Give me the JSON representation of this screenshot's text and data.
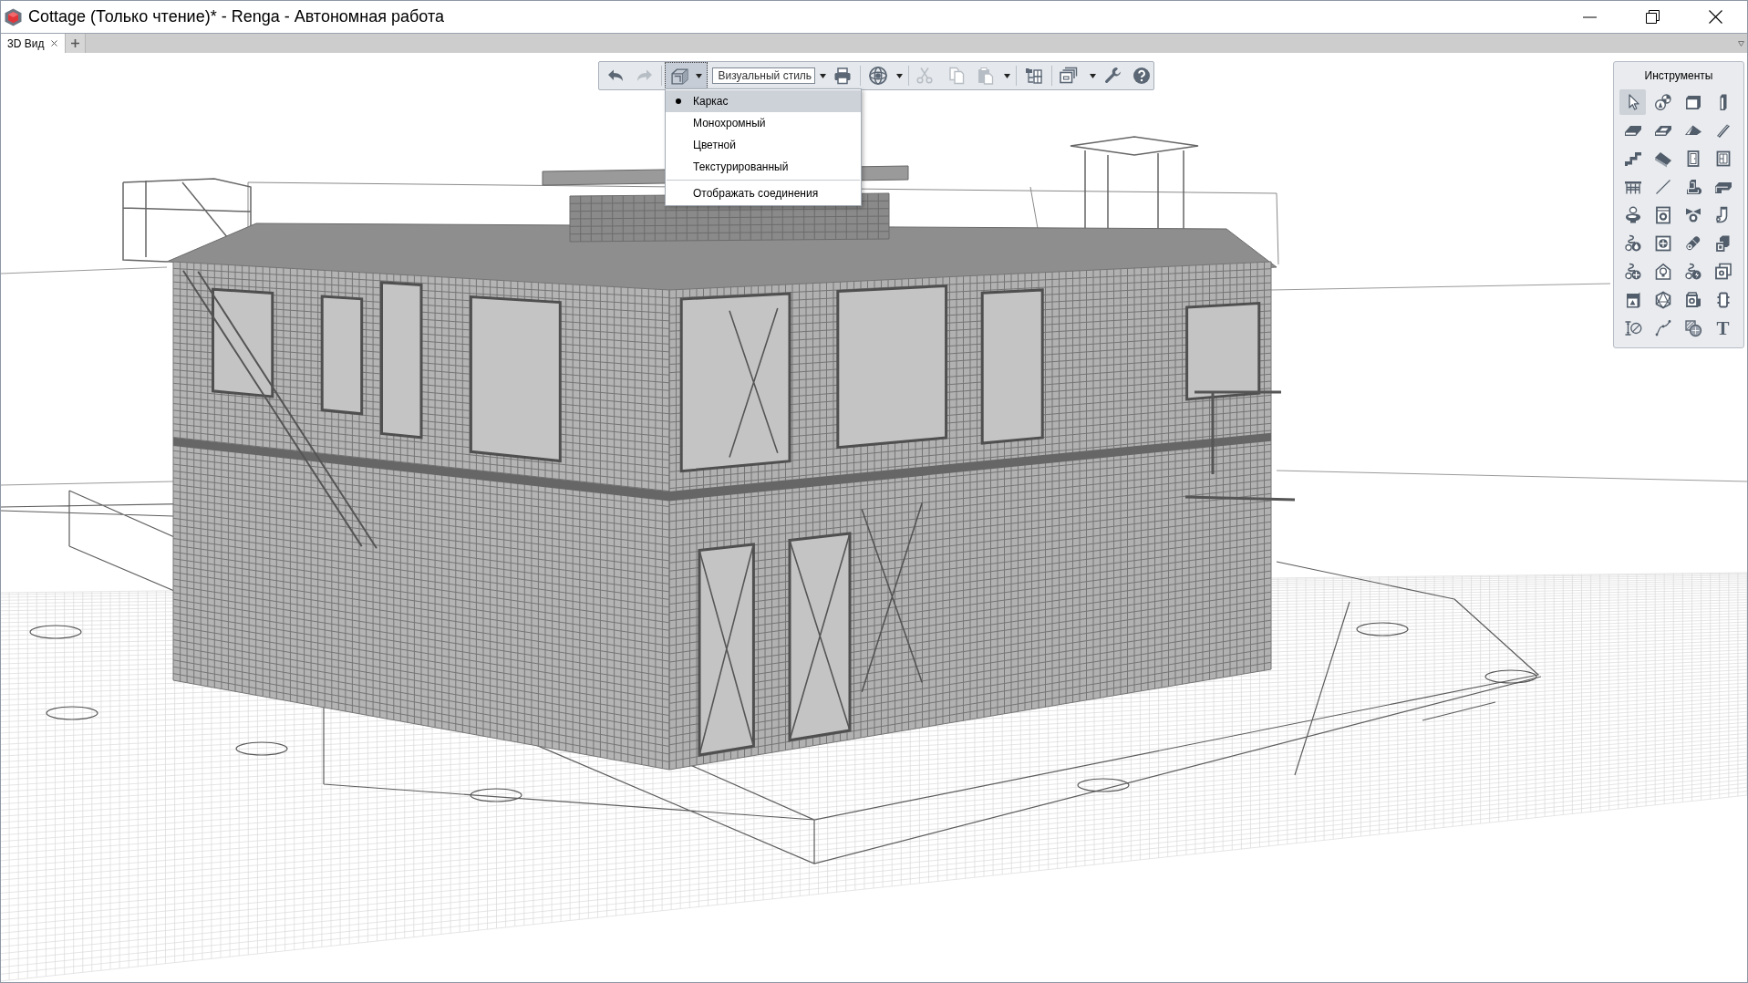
{
  "window": {
    "title": "Cottage (Только чтение)* - Renga - Автономная работа"
  },
  "tabs": [
    {
      "label": "3D Вид",
      "selected": true
    }
  ],
  "toolbar": {
    "undo": {
      "disabled": false
    },
    "redo": {
      "disabled": true
    },
    "view_style": {
      "pressed": true
    },
    "style_field": {
      "value": "Визуальный стиль"
    },
    "cut": {
      "disabled": true
    },
    "copy": {
      "disabled": true
    },
    "paste": {
      "disabled": true
    }
  },
  "view_style_menu": {
    "items": [
      {
        "kind": "option",
        "label": "Каркас",
        "selected": true
      },
      {
        "kind": "option",
        "label": "Монохромный",
        "selected": false
      },
      {
        "kind": "option",
        "label": "Цветной",
        "selected": false
      },
      {
        "kind": "option",
        "label": "Текстурированный",
        "selected": false
      },
      {
        "kind": "separator"
      },
      {
        "kind": "toggle",
        "label": "Отображать соединения",
        "checked": false
      }
    ]
  },
  "tools_panel": {
    "title": "Инструменты",
    "tools": [
      {
        "kind": "select",
        "selected": true
      },
      {
        "kind": "assembly",
        "selected": false
      },
      {
        "kind": "wall",
        "selected": false
      },
      {
        "kind": "column",
        "selected": false
      },
      {
        "kind": "floor",
        "selected": false
      },
      {
        "kind": "opening",
        "selected": false
      },
      {
        "kind": "roof",
        "selected": false
      },
      {
        "kind": "beam",
        "selected": false
      },
      {
        "kind": "stair",
        "selected": false
      },
      {
        "kind": "ramp",
        "selected": false
      },
      {
        "kind": "door",
        "selected": false
      },
      {
        "kind": "window",
        "selected": false
      },
      {
        "kind": "railing",
        "selected": false
      },
      {
        "kind": "line",
        "selected": false
      },
      {
        "kind": "foundation",
        "selected": false
      },
      {
        "kind": "strip",
        "selected": false
      },
      {
        "kind": "plumbing",
        "selected": false
      },
      {
        "kind": "equipment",
        "selected": false
      },
      {
        "kind": "valve",
        "selected": false
      },
      {
        "kind": "fitting",
        "selected": false
      },
      {
        "kind": "pipeline",
        "selected": false
      },
      {
        "kind": "fan",
        "selected": false
      },
      {
        "kind": "accessory",
        "selected": false
      },
      {
        "kind": "duct",
        "selected": false
      },
      {
        "kind": "ventilation",
        "selected": false
      },
      {
        "kind": "lamp",
        "selected": false
      },
      {
        "kind": "electric",
        "selected": false
      },
      {
        "kind": "outlet",
        "selected": false
      },
      {
        "kind": "panel",
        "selected": false
      },
      {
        "kind": "element",
        "selected": false
      },
      {
        "kind": "device",
        "selected": false
      },
      {
        "kind": "connector",
        "selected": false
      },
      {
        "kind": "dimension",
        "selected": false
      },
      {
        "kind": "curve",
        "selected": false
      },
      {
        "kind": "hatch",
        "selected": false
      },
      {
        "kind": "text",
        "label": "T",
        "selected": false
      }
    ]
  }
}
